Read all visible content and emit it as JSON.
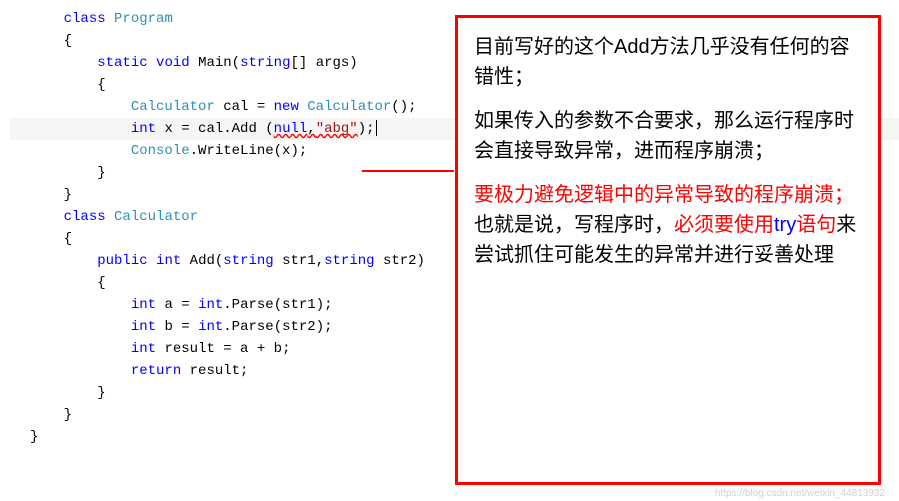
{
  "code": {
    "l1": {
      "kw": "class",
      "name": "Program"
    },
    "l2": "{",
    "l3": {
      "kw1": "static",
      "kw2": "void",
      "name": "Main",
      "kw3": "string",
      "rest": "[] args)"
    },
    "l4": "{",
    "l5": {
      "type1": "Calculator",
      "var": " cal = ",
      "kw": "new",
      "type2": "Calculator",
      "end": "();"
    },
    "l6": {
      "kw": "int",
      "var": " x = cal.Add (",
      "arg1": "null",
      "comma": ",",
      "arg2": "\"abg\"",
      "end": ");"
    },
    "l7": {
      "type": "Console",
      "rest": ".WriteLine(x);"
    },
    "l8": "}",
    "l9": "}",
    "l10": {
      "kw": "class",
      "name": "Calculator"
    },
    "l11": "{",
    "l12": {
      "kw1": "public",
      "kw2": "int",
      "name": " Add(",
      "kw3": "string",
      "p1": " str1,",
      "kw4": "string",
      "p2": " str2)"
    },
    "l13": "{",
    "l14": {
      "kw": "int",
      "var": " a = ",
      "kw2": "int",
      "rest": ".Parse(str1);"
    },
    "l15": {
      "kw": "int",
      "var": " b = ",
      "kw2": "int",
      "rest": ".Parse(str2);"
    },
    "l16": {
      "kw": "int",
      "rest": " result = a + b;"
    },
    "l17": {
      "kw": "return",
      "rest": " result;"
    },
    "l18_blank": "",
    "l18": "}",
    "l19": "}",
    "l20": "}"
  },
  "callout": {
    "p1": "目前写好的这个Add方法几乎没有任何的容错性；",
    "p2": "如果传入的参数不合要求，那么运行程序时会直接导致异常，进而程序崩溃；",
    "p3a": "要极力避免逻辑中的异常导致的程序崩溃；",
    "p3b_1": "也就是说，写程序时，",
    "p3b_2": "必须要使用",
    "p3b_try": "try",
    "p3b_3": "语句",
    "p3b_4": "来尝试抓住可能发生的异常并进行妥善处理"
  },
  "watermark": "https://blog.csdn.net/weixin_44813932"
}
